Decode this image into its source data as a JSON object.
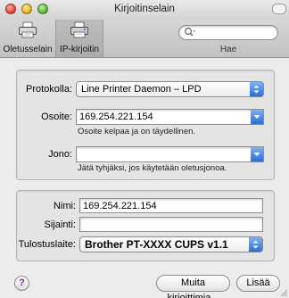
{
  "window": {
    "title": "Kirjoitinselain"
  },
  "toolbar": {
    "items": [
      {
        "label": "Oletusselain",
        "icon": "printer-icon",
        "selected": false
      },
      {
        "label": "IP-kirjoitin",
        "icon": "ip-printer-icon",
        "selected": true
      }
    ],
    "search": {
      "placeholder": "",
      "value": "",
      "label": "Hae"
    }
  },
  "form": {
    "protocol": {
      "label": "Protokolla:",
      "value": "Line Printer Daemon – LPD"
    },
    "address": {
      "label": "Osoite:",
      "value": "169.254.221.154",
      "hint": "Osoite kelpaa ja on täydellinen."
    },
    "queue": {
      "label": "Jono:",
      "value": "",
      "hint": "Jätä tyhjäksi, jos käytetään oletusjonoa."
    }
  },
  "details": {
    "name": {
      "label": "Nimi:",
      "value": "169.254.221.154"
    },
    "location": {
      "label": "Sijainti:",
      "value": ""
    },
    "driver": {
      "label": "Tulostuslaite:",
      "value": "Brother PT-XXXX CUPS v1.1"
    }
  },
  "buttons": {
    "help": "?",
    "more_printers": "Muita kirjoittimia...",
    "add": "Lisää"
  },
  "colors": {
    "accent": "#2a6fd6",
    "window_bg": "#ececec"
  }
}
